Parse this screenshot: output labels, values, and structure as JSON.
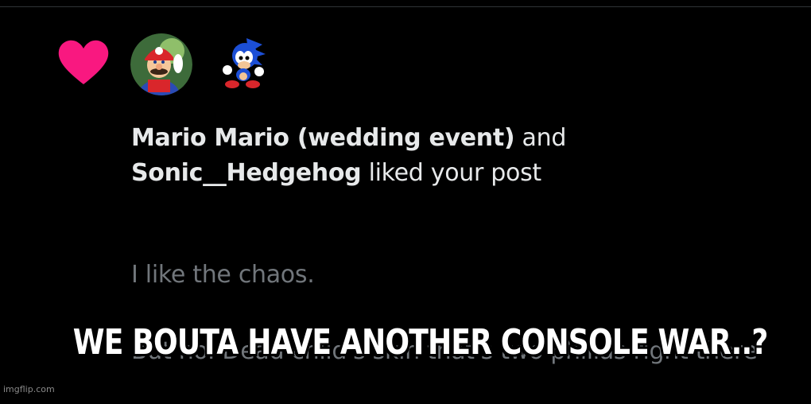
{
  "notification": {
    "icon": "heart-icon",
    "accent_color": "#f91880",
    "users": [
      {
        "name": "Mario Mario (wedding event)",
        "avatar": "mario-avatar"
      },
      {
        "name": "Sonic__Hedgehog",
        "avatar": "sonic-avatar"
      }
    ],
    "connector": " and ",
    "action": " liked your post"
  },
  "post": {
    "line1": "I like the chaos.",
    "line2": "But no. Dead child's skin that's two phillas right there"
  },
  "meme": {
    "caption": "WE BOUTA HAVE ANOTHER CONSOLE WAR..?"
  },
  "watermark": "imgflip.com"
}
